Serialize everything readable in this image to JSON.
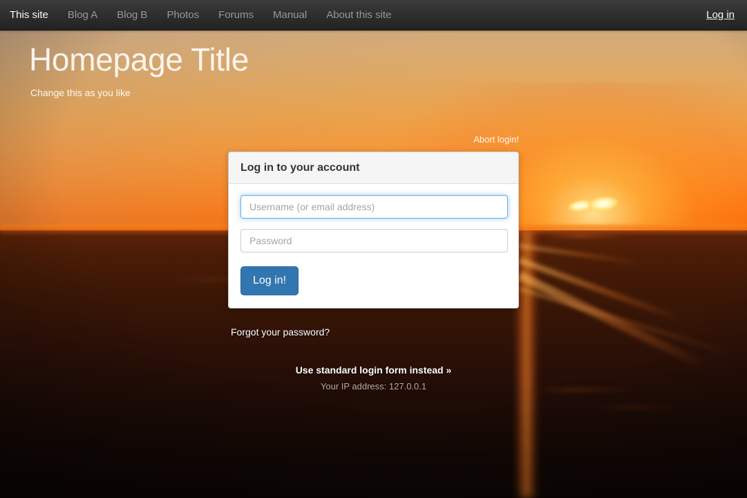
{
  "navbar": {
    "brand_items": [
      {
        "label": "This site",
        "active": true
      },
      {
        "label": "Blog A",
        "active": false
      },
      {
        "label": "Blog B",
        "active": false
      },
      {
        "label": "Photos",
        "active": false
      },
      {
        "label": "Forums",
        "active": false
      },
      {
        "label": "Manual",
        "active": false
      },
      {
        "label": "About this site",
        "active": false
      }
    ],
    "login_link": "Log in",
    "background_color": "#2f2f2f",
    "active_text_color": "#ffffff",
    "inactive_text_color": "#9d9d9d"
  },
  "hero": {
    "title": "Homepage Title",
    "subtitle": "Change this as you like"
  },
  "login": {
    "abort_link": "Abort login!",
    "panel_title": "Log in to your account",
    "username": {
      "value": "",
      "placeholder": "Username (or email address)",
      "focused": true
    },
    "password": {
      "value": "",
      "placeholder": "Password",
      "focused": false
    },
    "submit_label": "Log in!",
    "submit_color": "#3276b1",
    "forgot_link": "Forgot your password?",
    "alt_form_link": "Use standard login form instead »",
    "ip_note": "Your IP address: 127.0.0.1"
  },
  "background": {
    "scene": "sunset-photo",
    "sky_top_color": "#c8a688",
    "sky_horizon_color": "#f9700c",
    "ground_color": "#3a1606",
    "sun_color": "#fffdf0"
  }
}
